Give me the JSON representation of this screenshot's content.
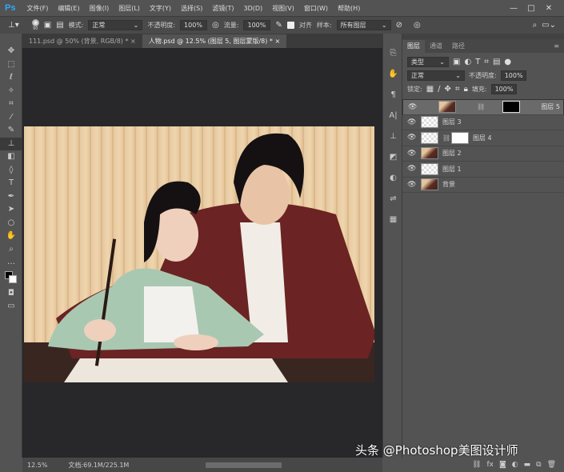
{
  "app": {
    "logo": "Ps"
  },
  "menu": [
    "文件(F)",
    "编辑(E)",
    "图像(I)",
    "图层(L)",
    "文字(Y)",
    "选择(S)",
    "滤镜(T)",
    "3D(D)",
    "视图(V)",
    "窗口(W)",
    "帮助(H)"
  ],
  "window_controls": {
    "minimize": "—",
    "maximize": "□",
    "close": "✕"
  },
  "options": {
    "brush_size": "90",
    "mode_label": "模式:",
    "mode_value": "正常",
    "opacity_label": "不透明度:",
    "opacity_value": "100%",
    "flow_label": "流量:",
    "flow_value": "100%",
    "align_label": "对齐",
    "sample_label": "样本:",
    "sample_value": "所有图层"
  },
  "tabs": [
    {
      "label": "111.psd @ 50% (背景, RGB/8) *",
      "close": "×"
    },
    {
      "label": "人物.psd @ 12.5% (图层 5, 图层蒙版/8) *",
      "close": "×"
    }
  ],
  "panel": {
    "tabs": [
      "图层",
      "通道",
      "路径"
    ],
    "filter_value": "类型",
    "blend_value": "正常",
    "opacity_label": "不透明度:",
    "opacity_value": "100%",
    "lock_label": "锁定:",
    "fill_label": "填充:",
    "fill_value": "100%",
    "layers": [
      {
        "name": "图层 5"
      },
      {
        "name": "图层 3"
      },
      {
        "name": "图层 4"
      },
      {
        "name": "图层 2"
      },
      {
        "name": "图层 1"
      },
      {
        "name": "背景"
      }
    ]
  },
  "status": {
    "zoom": "12.5%",
    "doc": "文档:69.1M/225.1M"
  },
  "watermark": "头条 @Photoshop美图设计师"
}
